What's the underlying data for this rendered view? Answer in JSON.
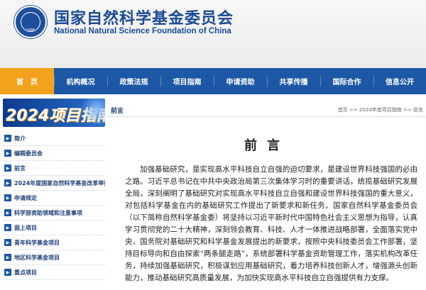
{
  "header": {
    "emblem_year": "1986",
    "title_cn": "国家自然科学基金委员会",
    "title_en": "National Natural Science Foundation of China"
  },
  "nav": {
    "items": [
      "首　页",
      "机构概况",
      "政策法规",
      "项目指南",
      "申请资助",
      "共享传播",
      "国际合作",
      "信息公开"
    ]
  },
  "sidebar": {
    "banner": "2024项目指南",
    "items": [
      "简介",
      "编辑委员会",
      "前言",
      "2024年度国家自然科学基金改革举措",
      "申请规定",
      "科学部资助领域和注意事项",
      "面上项目",
      "青年科学基金项目",
      "地区科学基金项目",
      "重点项目"
    ]
  },
  "main": {
    "crumb_title": "前言",
    "breadcrumb": "首页 >> 2024年度项目指南 >> 前言",
    "page_title": "前言",
    "paragraph": "加强基础研究，是实现高水平科技自立自强的迫切要求，是建设世界科技强国的必由之路。习近平总书记在中共中央政治局第三次集体学习时的重要讲话，统揽基础研究发展全局，深刻阐明了基础研究对实现高水平科技自立自强和建设世界科技强国的重大意义，对包括科学基金在内的基础研究工作提出了新要求和新任务。国家自然科学基金委员会（以下简称自然科学基金委）将坚持以习近平新时代中国特色社会主义思想为指导，认真学习贯彻党的二十大精神，深刻领会教育、科技、人才一体推进战略部署，全面落实党中央、国务院对基础研究和科学基金发展提出的新要求，按照中央科技委员会工作部署，坚持目标导向和自由探索“两条腿走路”，系统部署科学基金资助管理工作，落实机构改革任务，持续加强基础研究，积极谋划应用基础研究，着力培养科技创新人才，增强源头创新能力，推动基础研究高质量发展，为加快实现高水平科技自立自强提供有力支撑。"
  }
}
